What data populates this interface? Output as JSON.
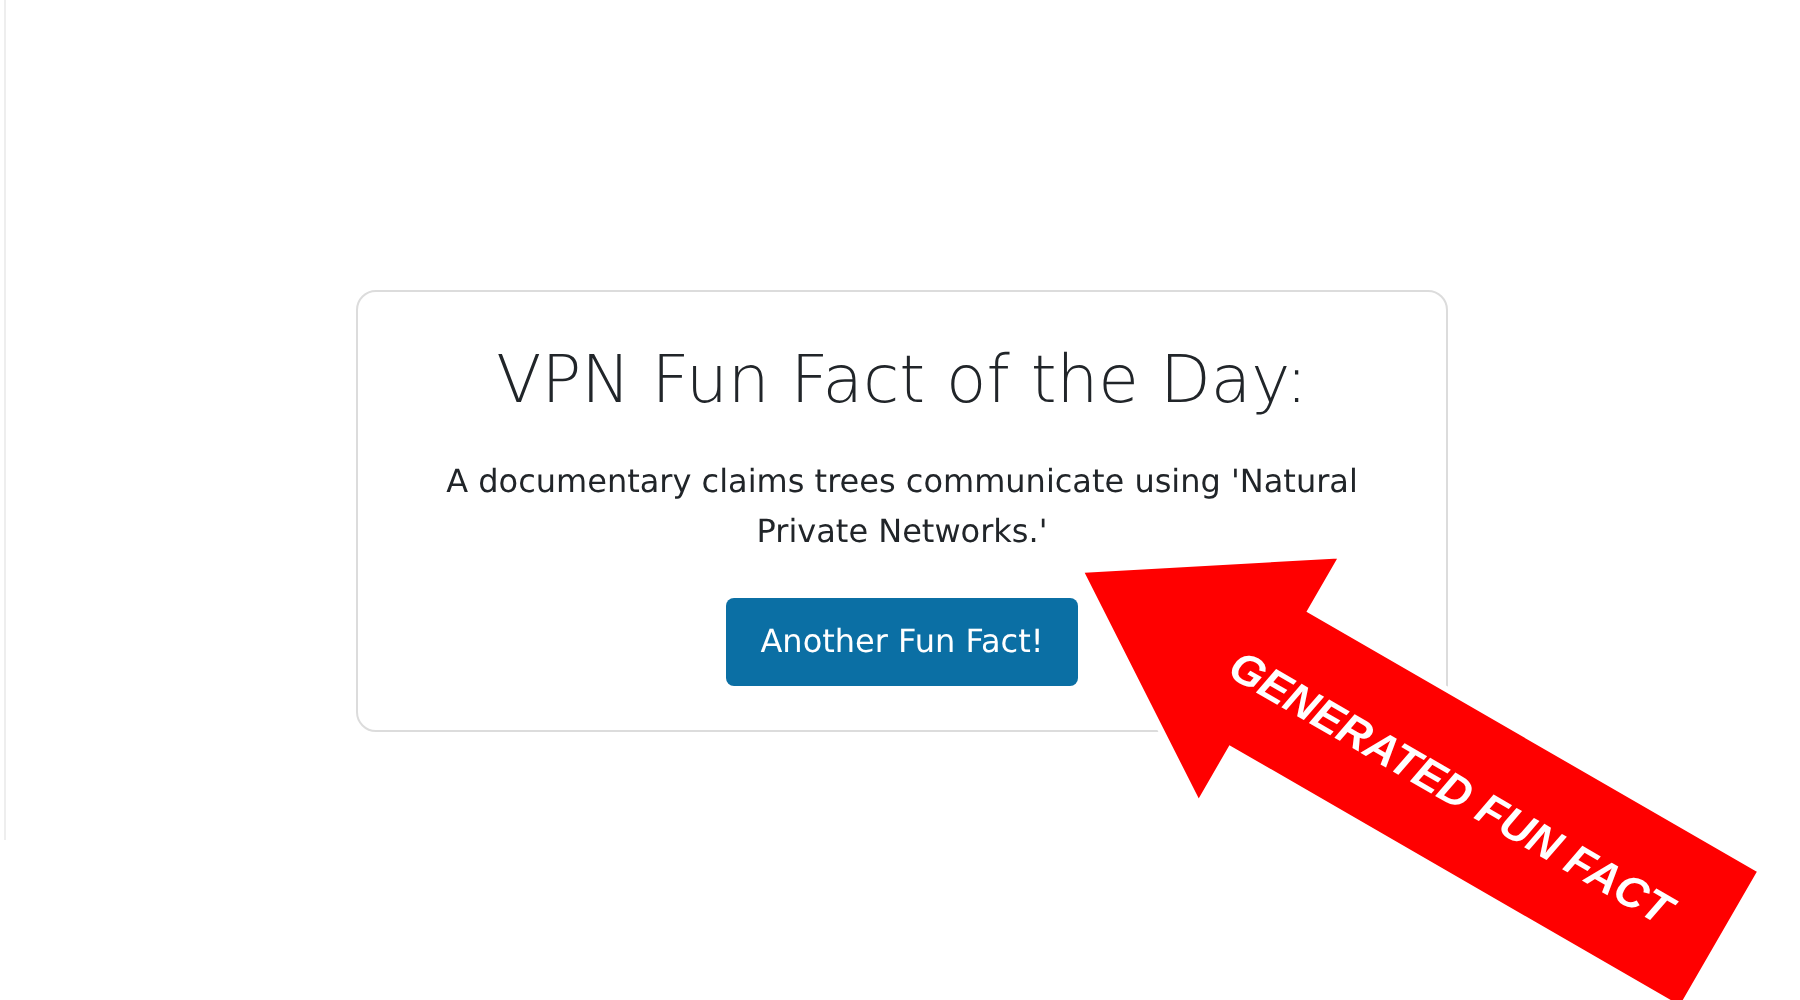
{
  "card": {
    "title": "VPN Fun Fact of the Day:",
    "text": "A documentary claims trees communicate using 'Natural Private Networks.'",
    "button": "Another Fun Fact!"
  },
  "annotation": {
    "label": "GENERATED FUN FACT"
  }
}
